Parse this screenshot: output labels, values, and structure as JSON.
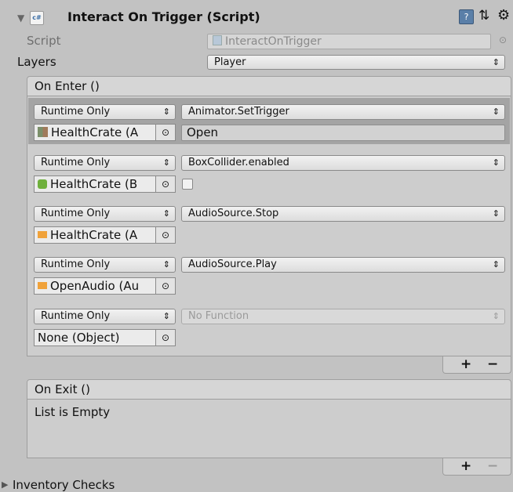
{
  "component": {
    "title": "Interact On Trigger (Script)",
    "script_label": "Script",
    "script_value": "InteractOnTrigger",
    "layers_label": "Layers",
    "layers_value": "Player"
  },
  "on_enter": {
    "header": "On Enter ()",
    "entries": [
      {
        "mode": "Runtime Only",
        "function": "Animator.SetTrigger",
        "object": "HealthCrate (A",
        "object_icon": "animator-icon",
        "argument": "Open"
      },
      {
        "mode": "Runtime Only",
        "function": "BoxCollider.enabled",
        "object": "HealthCrate (B",
        "object_icon": "boxcollider-icon"
      },
      {
        "mode": "Runtime Only",
        "function": "AudioSource.Stop",
        "object": "HealthCrate (A",
        "object_icon": "audiosource-icon"
      },
      {
        "mode": "Runtime Only",
        "function": "AudioSource.Play",
        "object": "OpenAudio (Au",
        "object_icon": "audiosource-icon"
      },
      {
        "mode": "Runtime Only",
        "function": "No Function",
        "object": "None (Object)"
      }
    ]
  },
  "on_exit": {
    "header": "On Exit ()",
    "empty_text": "List is Empty"
  },
  "controls": {
    "add": "+",
    "remove": "−"
  },
  "foldouts": {
    "inventory_checks": "Inventory Checks"
  }
}
